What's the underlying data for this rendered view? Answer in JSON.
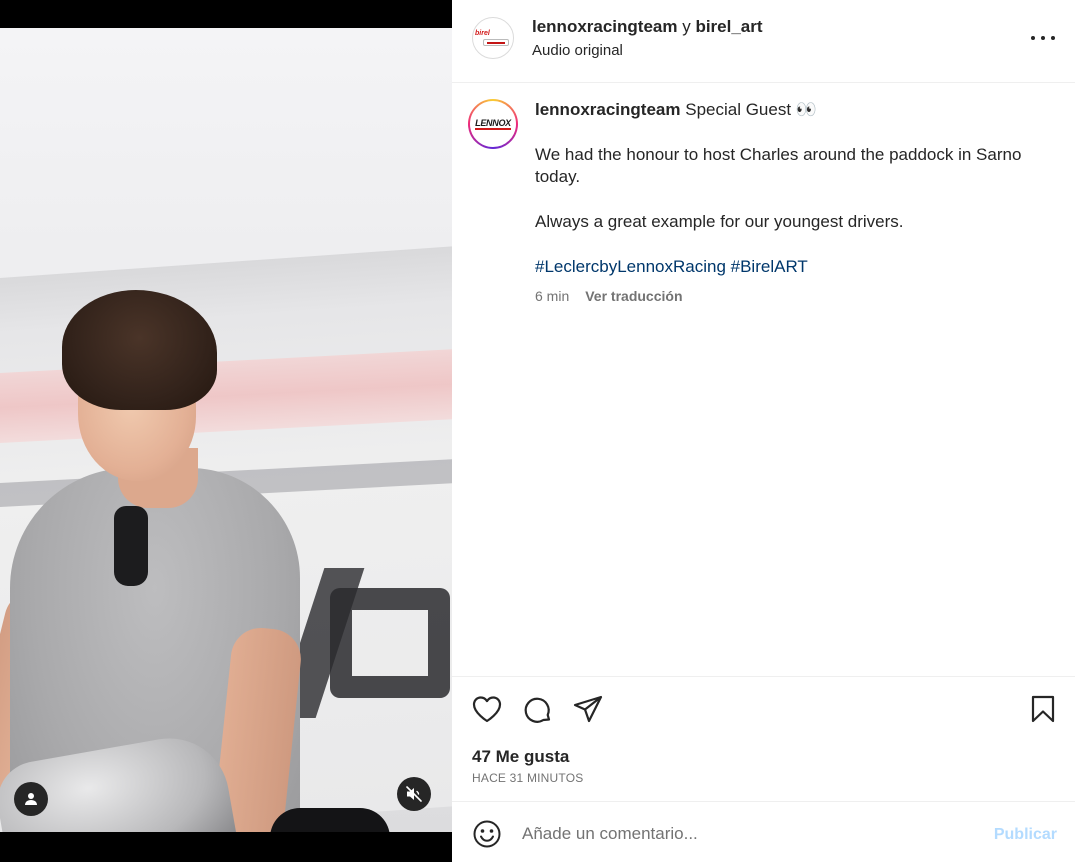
{
  "post": {
    "header": {
      "author_primary": "lennoxracingteam",
      "connector": " y ",
      "author_secondary": "birel_art",
      "audio": "Audio original",
      "more_icon": "more-horizontal-icon"
    },
    "caption": {
      "username": "lennoxracingteam",
      "headline": "Special Guest 👀",
      "paragraph1": "We had the honour to host Charles around the paddock in Sarno today.",
      "paragraph2": "Always a great example for our youngest drivers.",
      "hashtag1": "#LeclercbyLennoxRacing",
      "hashtag2": "#BirelART",
      "age": "6 min",
      "translate": "Ver traducción"
    },
    "actions": {
      "likes": "47 Me gusta",
      "timestamp": "HACE 31 MINUTOS",
      "icons": [
        "heart-icon",
        "comment-icon",
        "share-icon",
        "bookmark-icon"
      ]
    },
    "comment": {
      "placeholder": "Añade un comentario...",
      "publish": "Publicar",
      "publish_color": "#b3dbff"
    },
    "media": {
      "user_tag_icon": "user-tag-icon",
      "mute_icon": "volume-muted-icon"
    }
  },
  "colors": {
    "text": "#262626",
    "muted": "#737373",
    "hashtag": "#00376b",
    "border": "#efefef"
  }
}
